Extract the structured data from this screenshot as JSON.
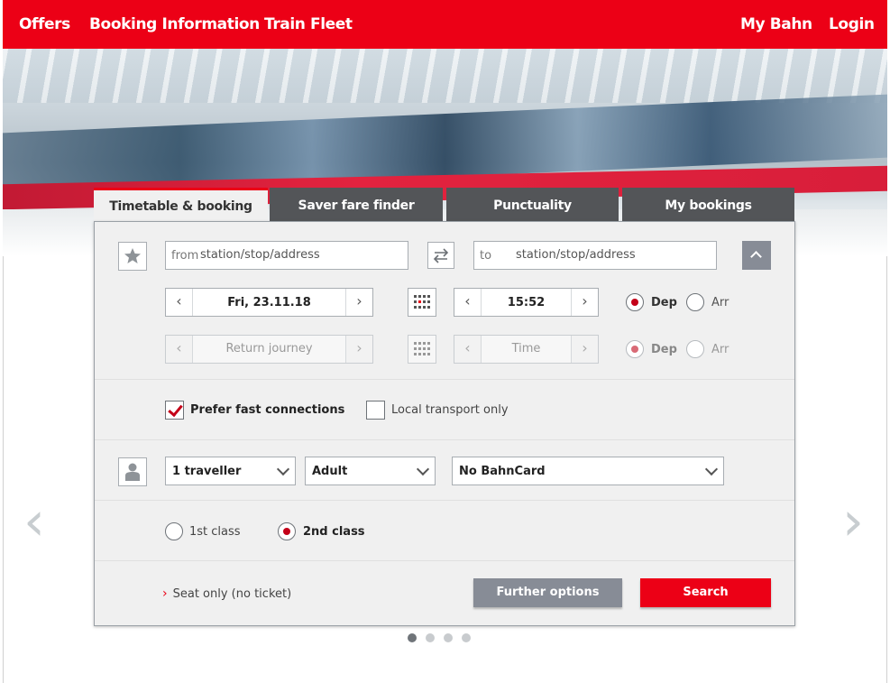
{
  "nav": {
    "left": [
      "Offers",
      "Booking Information",
      "Train Fleet"
    ],
    "right": [
      "My Bahn",
      "Login"
    ]
  },
  "tabs": [
    "Timetable & booking",
    "Saver fare finder",
    "Punctuality",
    "My bookings"
  ],
  "journey": {
    "from_prefix": "from",
    "from_placeholder": "station/stop/address",
    "to_prefix": "to",
    "to_placeholder": "station/stop/address",
    "date": "Fri, 23.11.18",
    "time": "15:52",
    "dep_label": "Dep",
    "arr_label": "Arr",
    "return_placeholder": "Return journey",
    "return_time_placeholder": "Time"
  },
  "options": {
    "prefer_fast": "Prefer fast connections",
    "local_only": "Local transport only"
  },
  "travellers": {
    "count": "1 traveller",
    "type": "Adult",
    "bahncard": "No BahnCard"
  },
  "class": {
    "first": "1st class",
    "second": "2nd class"
  },
  "footer": {
    "seat_only": "Seat only (no ticket)",
    "further_options": "Further options",
    "search": "Search"
  },
  "carousel": {
    "slides": 4,
    "active": 1
  },
  "colors": {
    "brand_red": "#ec0016",
    "grey_button": "#878c96",
    "tab_dark": "#535558"
  }
}
